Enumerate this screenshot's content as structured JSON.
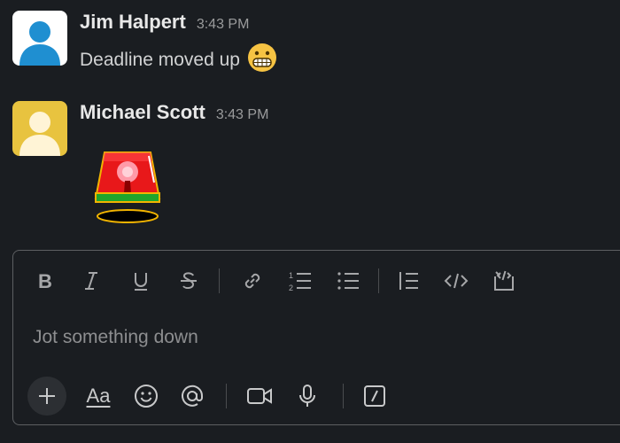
{
  "messages": [
    {
      "author": "Jim Halpert",
      "time": "3:43 PM",
      "text": "Deadline moved up",
      "emoji": "grimacing-face",
      "avatar_color": "#1f8fd1"
    },
    {
      "author": "Michael Scott",
      "time": "3:43 PM",
      "attachment": "siren-gif",
      "avatar_color": "#e8c33f"
    }
  ],
  "composer": {
    "placeholder": "Jot something down",
    "format_tools": [
      "bold-icon",
      "italic-icon",
      "underline-icon",
      "strikethrough-icon",
      "link-icon",
      "ordered-list-icon",
      "bulleted-list-icon",
      "blockquote-icon",
      "code-icon",
      "code-block-icon"
    ],
    "bottom_tools": [
      "plus-icon",
      "text-format-icon",
      "emoji-icon",
      "mention-icon",
      "video-icon",
      "microphone-icon",
      "slash-command-icon"
    ],
    "text_format_label": "Aa"
  },
  "colors": {
    "background": "#1a1d21",
    "text": "#d1d2d3",
    "muted": "#9a9b9c",
    "border": "#5d5f62"
  }
}
